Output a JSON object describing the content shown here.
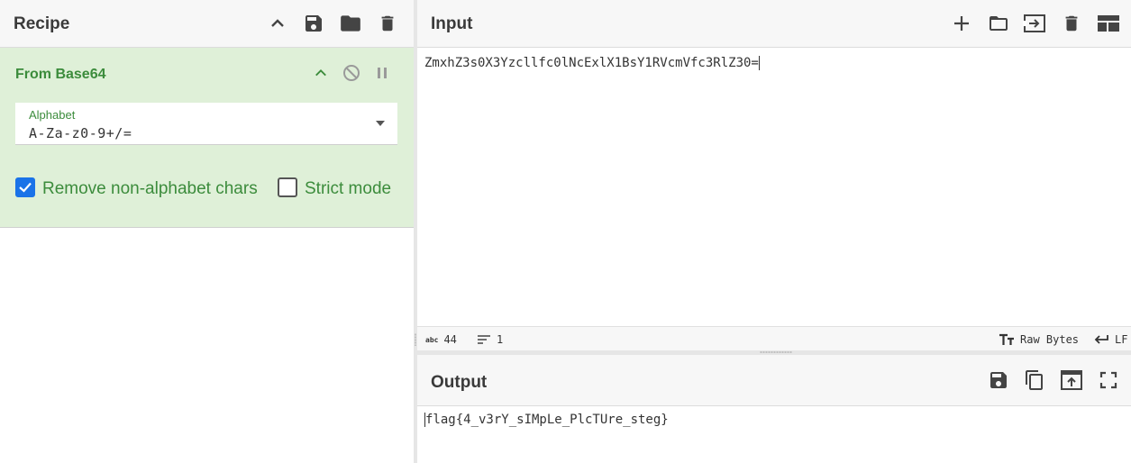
{
  "recipe": {
    "title": "Recipe",
    "icons": [
      "chevron-up-icon",
      "save-icon",
      "folder-icon",
      "trash-icon"
    ]
  },
  "operation": {
    "name": "From Base64",
    "alphabet_label": "Alphabet",
    "alphabet_value": "A-Za-z0-9+/=",
    "remove_nonalpha_label": "Remove non-alphabet chars",
    "remove_nonalpha_checked": true,
    "strict_mode_label": "Strict mode",
    "strict_mode_checked": false
  },
  "input": {
    "title": "Input",
    "text": "ZmxhZ3s0X3Yzcllfc0lNcExlX1BsY1RVcmVfc3RlZ30="
  },
  "status": {
    "chars_icon": "abc",
    "chars": "44",
    "lines": "1",
    "raw_bytes_label": "Raw Bytes",
    "newline_label": "LF"
  },
  "output": {
    "title": "Output",
    "text": "flag{4_v3rY_sIMpLe_PlcTUre_steg}"
  },
  "colors": {
    "accent_green": "#3c8c3c",
    "operation_bg": "#dff0d8",
    "checkbox_blue": "#1a73e8"
  }
}
